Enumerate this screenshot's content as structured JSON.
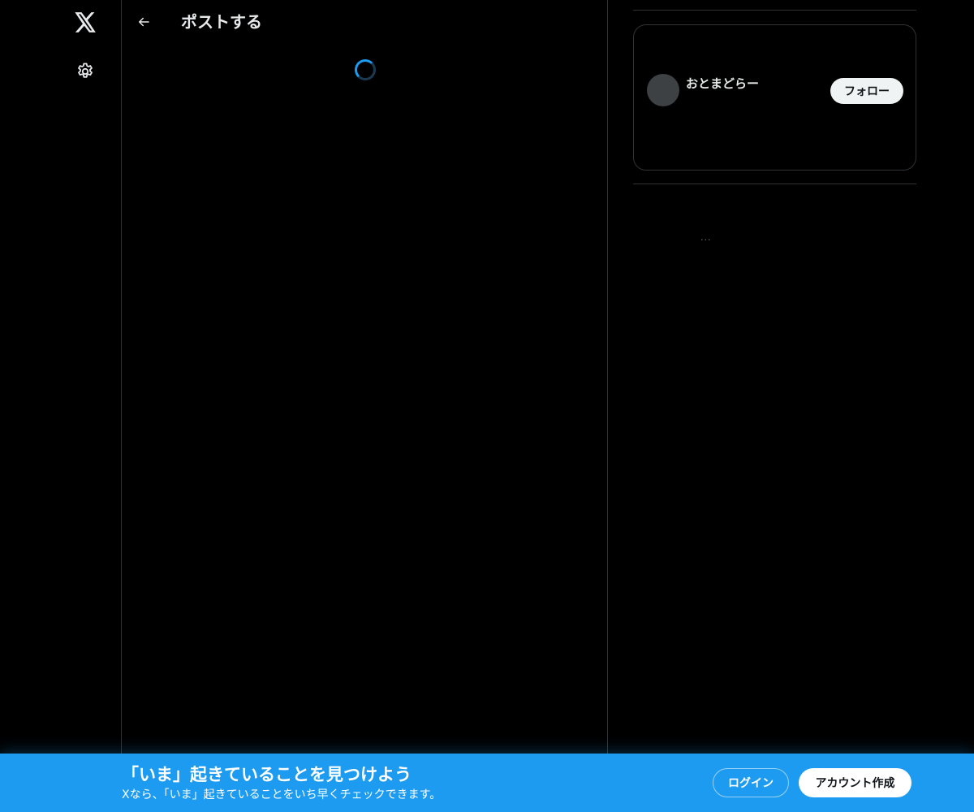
{
  "nav": {
    "logo_icon": "x-logo-icon",
    "settings_icon": "gear-icon"
  },
  "header": {
    "back_icon": "arrow-left-icon",
    "title": "ポストする"
  },
  "main": {
    "loading_icon": "spinner-icon"
  },
  "sidebar": {
    "profile": {
      "name": "おとまどらー",
      "follow_label": "フォロー"
    },
    "more_label": "..."
  },
  "banner": {
    "title": "「いま」起きていることを見つけよう",
    "subtitle": "Xなら、「いま」起きていることをいち早くチェックできます。",
    "login_label": "ログイン",
    "signup_label": "アカウント作成"
  },
  "colors": {
    "background": "#000000",
    "accent": "#1d9bf0",
    "border": "#2f3336",
    "text": "#e7e9ea"
  }
}
